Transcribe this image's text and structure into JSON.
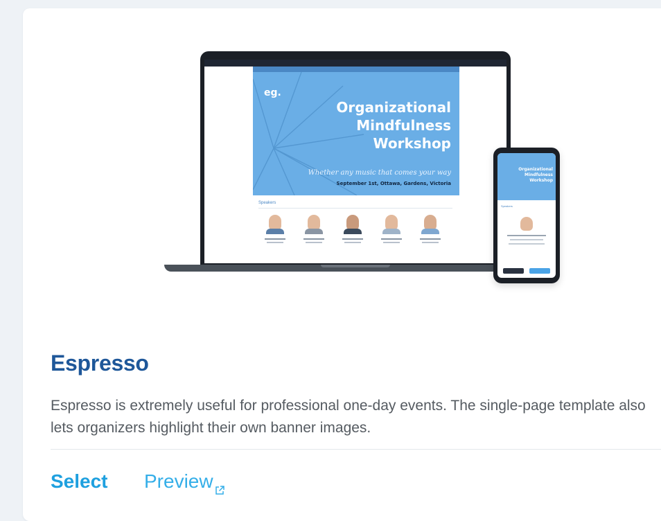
{
  "template": {
    "name": "Espresso",
    "description": "Espresso is extremely useful for professional one-day events. The single-page template also lets organizers highlight their own banner images.",
    "actions": {
      "select_label": "Select",
      "preview_label": "Preview",
      "preview_icon": "external-link-icon"
    }
  },
  "mockup": {
    "logo": "eg.",
    "title_lines": [
      "Organizational",
      "Mindfulness",
      "Workshop"
    ],
    "tagline": "Whether any music that comes your way",
    "date_location": "September 1st, Ottawa, Gardens, Victoria",
    "section_label": "Speakers"
  },
  "colors": {
    "title": "#1e5799",
    "link": "#1ea0df",
    "banner": "#6aaee6"
  }
}
